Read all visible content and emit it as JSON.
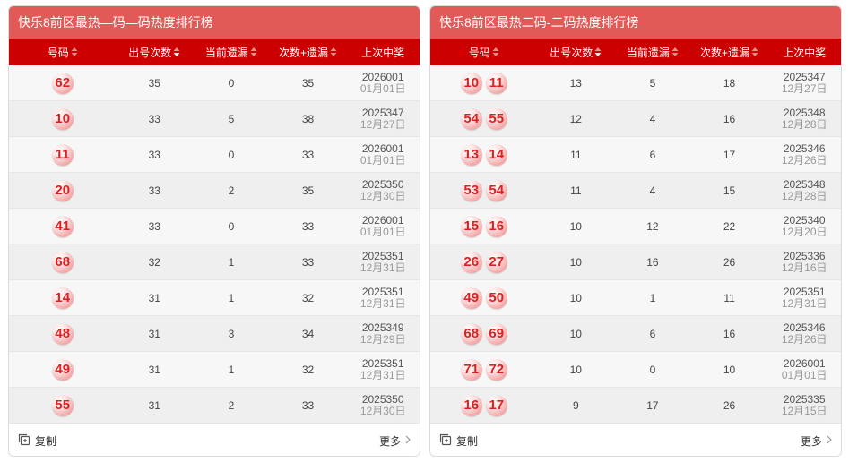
{
  "panels": [
    {
      "title": "快乐8前区最热—码—码热度排行榜",
      "headers": [
        "号码",
        "出号次数",
        "当前遗漏",
        "次数+遗漏",
        "上次中奖"
      ],
      "rows": [
        {
          "balls": [
            "62"
          ],
          "count": "35",
          "miss": "0",
          "sum": "35",
          "issue": "2026001",
          "date": "01月01日"
        },
        {
          "balls": [
            "10"
          ],
          "count": "33",
          "miss": "5",
          "sum": "38",
          "issue": "2025347",
          "date": "12月27日"
        },
        {
          "balls": [
            "11"
          ],
          "count": "33",
          "miss": "0",
          "sum": "33",
          "issue": "2026001",
          "date": "01月01日"
        },
        {
          "balls": [
            "20"
          ],
          "count": "33",
          "miss": "2",
          "sum": "35",
          "issue": "2025350",
          "date": "12月30日"
        },
        {
          "balls": [
            "41"
          ],
          "count": "33",
          "miss": "0",
          "sum": "33",
          "issue": "2026001",
          "date": "01月01日"
        },
        {
          "balls": [
            "68"
          ],
          "count": "32",
          "miss": "1",
          "sum": "33",
          "issue": "2025351",
          "date": "12月31日"
        },
        {
          "balls": [
            "14"
          ],
          "count": "31",
          "miss": "1",
          "sum": "32",
          "issue": "2025351",
          "date": "12月31日"
        },
        {
          "balls": [
            "48"
          ],
          "count": "31",
          "miss": "3",
          "sum": "34",
          "issue": "2025349",
          "date": "12月29日"
        },
        {
          "balls": [
            "49"
          ],
          "count": "31",
          "miss": "1",
          "sum": "32",
          "issue": "2025351",
          "date": "12月31日"
        },
        {
          "balls": [
            "55"
          ],
          "count": "31",
          "miss": "2",
          "sum": "33",
          "issue": "2025350",
          "date": "12月30日"
        }
      ],
      "footer": {
        "copy_label": "复制",
        "more_label": "更多"
      }
    },
    {
      "title": "快乐8前区最热二码-二码热度排行榜",
      "headers": [
        "号码",
        "出号次数",
        "当前遗漏",
        "次数+遗漏",
        "上次中奖"
      ],
      "rows": [
        {
          "balls": [
            "10",
            "11"
          ],
          "count": "13",
          "miss": "5",
          "sum": "18",
          "issue": "2025347",
          "date": "12月27日"
        },
        {
          "balls": [
            "54",
            "55"
          ],
          "count": "12",
          "miss": "4",
          "sum": "16",
          "issue": "2025348",
          "date": "12月28日"
        },
        {
          "balls": [
            "13",
            "14"
          ],
          "count": "11",
          "miss": "6",
          "sum": "17",
          "issue": "2025346",
          "date": "12月26日"
        },
        {
          "balls": [
            "53",
            "54"
          ],
          "count": "11",
          "miss": "4",
          "sum": "15",
          "issue": "2025348",
          "date": "12月28日"
        },
        {
          "balls": [
            "15",
            "16"
          ],
          "count": "10",
          "miss": "12",
          "sum": "22",
          "issue": "2025340",
          "date": "12月20日"
        },
        {
          "balls": [
            "26",
            "27"
          ],
          "count": "10",
          "miss": "16",
          "sum": "26",
          "issue": "2025336",
          "date": "12月16日"
        },
        {
          "balls": [
            "49",
            "50"
          ],
          "count": "10",
          "miss": "1",
          "sum": "11",
          "issue": "2025351",
          "date": "12月31日"
        },
        {
          "balls": [
            "68",
            "69"
          ],
          "count": "10",
          "miss": "6",
          "sum": "16",
          "issue": "2025346",
          "date": "12月26日"
        },
        {
          "balls": [
            "71",
            "72"
          ],
          "count": "10",
          "miss": "0",
          "sum": "10",
          "issue": "2026001",
          "date": "01月01日"
        },
        {
          "balls": [
            "16",
            "17"
          ],
          "count": "9",
          "miss": "17",
          "sum": "26",
          "issue": "2025335",
          "date": "12月15日"
        }
      ],
      "footer": {
        "copy_label": "复制",
        "more_label": "更多"
      }
    }
  ],
  "icons": {
    "copy": "copy-icon",
    "sort": "sort-icon",
    "more": "chevron-right-icon"
  },
  "colors": {
    "title_bg": "#e15a58",
    "header_bg": "#cc0000",
    "ball_text": "#e02020"
  }
}
